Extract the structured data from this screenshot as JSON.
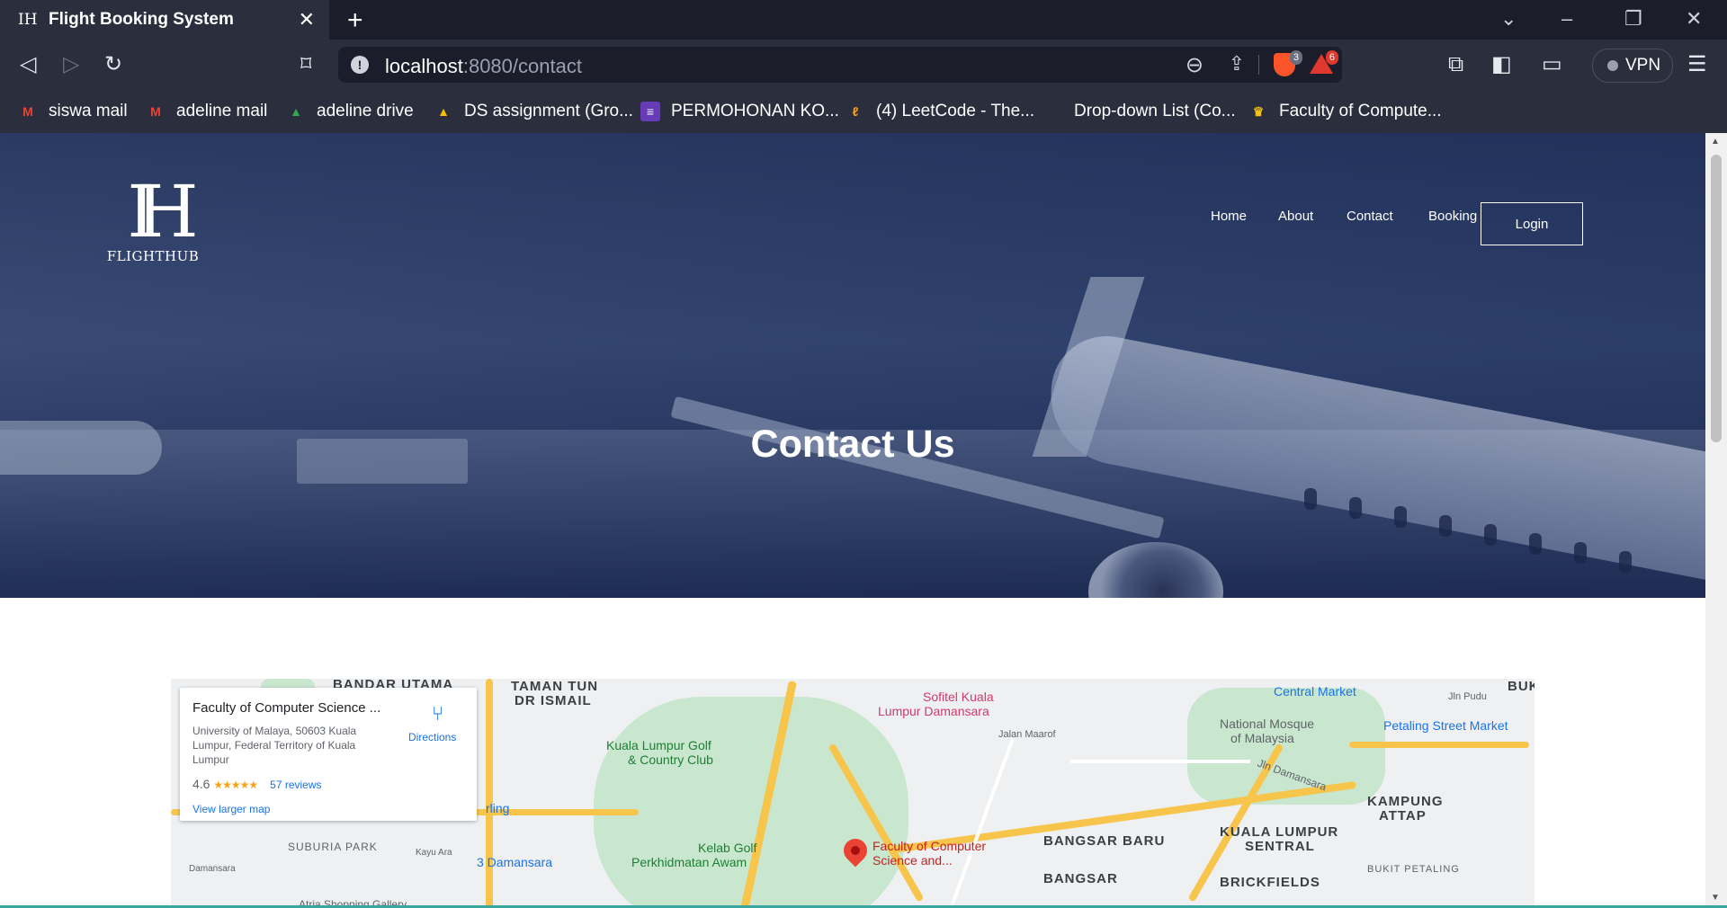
{
  "browser": {
    "tab_title": "Flight Booking System",
    "tab_icon": "flighthub-favicon",
    "url_host": "localhost",
    "url_rest": ":8080/contact",
    "shield_count": "3",
    "rewards_count": "6",
    "vpn_label": "VPN",
    "bookmarks": [
      {
        "label": "siswa mail",
        "icon": "gmail-icon"
      },
      {
        "label": "adeline mail",
        "icon": "gmail-icon"
      },
      {
        "label": "adeline drive",
        "icon": "google-drive-icon"
      },
      {
        "label": "DS assignment (Gro...",
        "icon": "google-drive-icon"
      },
      {
        "label": "PERMOHONAN KO...",
        "icon": "google-forms-icon"
      },
      {
        "label": "(4) LeetCode - The...",
        "icon": "leetcode-icon"
      },
      {
        "label": "Drop-down List (Co...",
        "icon": ""
      },
      {
        "label": "Faculty of Compute...",
        "icon": "university-crest-icon"
      }
    ]
  },
  "site": {
    "logo_text": "FLIGHTHUB",
    "nav": [
      "Home",
      "About",
      "Contact",
      "Booking"
    ],
    "login_label": "Login",
    "hero_title": "Contact Us"
  },
  "map": {
    "place_name": "Faculty of Computer Science ...",
    "address": "University of Malaya, 50603 Kuala Lumpur, Federal Territory of Kuala Lumpur",
    "rating": "4.6",
    "stars": "★★★★★",
    "reviews": "57 reviews",
    "view_larger": "View larger map",
    "directions": "Directions",
    "labels": {
      "bandar_utama": "BANDAR UTAMA",
      "taman_tun": "TAMAN TUN",
      "dr_ismail": "DR ISMAIL",
      "golf_club": "Kuala Lumpur Golf",
      "golf_club2": "& Country Club",
      "sofitel": "Sofitel Kuala",
      "sofitel2": "Lumpur Damansara",
      "central_market": "Central Market",
      "national_mosque": "National Mosque",
      "national_mosque2": "of Malaysia",
      "petaling": "Petaling Street Market",
      "kampung": "KAMPUNG",
      "attap": "ATTAP",
      "klsentral": "KUALA LUMPUR",
      "klsentral2": "SENTRAL",
      "bangsar_baru": "BANGSAR BARU",
      "bangsar": "BANGSAR",
      "brickfields": "BRICKFIELDS",
      "subur": "SUBURIA PARK",
      "damansara3": "3 Damansara",
      "kelab_golf": "Kelab Golf",
      "kelab_golf2": "Perkhidmatan Awam",
      "faculty_pin": "Faculty of Computer",
      "faculty_pin2": "Science and...",
      "rling": "rling",
      "jalan_maarof": "Jalan Maarof",
      "bukit_petaling": "BUKIT PETALING",
      "buk": "BUK",
      "jln_damansara": "Jln Damansara",
      "damansara_small": "Damansara",
      "kayu_ara": "Kayu Ara",
      "atria": "Atria Shopping Gallery",
      "jln_pudu": "Jln Pudu"
    }
  },
  "colors": {
    "browser_dark": "#1b1d2a",
    "browser_bar": "#2b2e3d",
    "hero_overlay": "#1c2c56",
    "map_road": "#f7c54c",
    "map_park": "#c9e7cf",
    "link_blue": "#1a73e8"
  }
}
